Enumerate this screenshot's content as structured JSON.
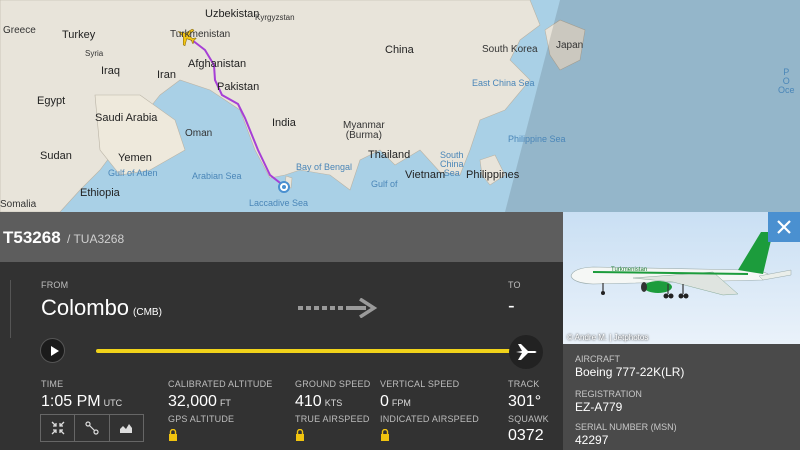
{
  "map": {
    "labels": {
      "uzbekistan": "Uzbekistan",
      "kyrgyzstan": "Kyrgyzstan",
      "turkmenistan": "Turkmenistan",
      "greece": "Greece",
      "turkey": "Turkey",
      "syria": "Syria",
      "iraq": "Iraq",
      "iran": "Iran",
      "afghanistan": "Afghanistan",
      "pakistan": "Pakistan",
      "china": "China",
      "south_korea": "South Korea",
      "japan": "Japan",
      "egypt": "Egypt",
      "saudi_arabia": "Saudi Arabia",
      "oman": "Oman",
      "india": "India",
      "myanmar": "Myanmar\n(Burma)",
      "east_china_sea": "East China Sea",
      "sudan": "Sudan",
      "yemen": "Yemen",
      "thailand": "Thailand",
      "south_china_sea": "South\nChina\nSea",
      "philippine_sea": "Philippine Sea",
      "gulf_of_aden": "Gulf of Aden",
      "bay_of_bengal": "Bay of Bengal",
      "arabian_sea": "Arabian Sea",
      "gulf_of": "Gulf of",
      "vietnam": "Vietnam",
      "philippines": "Philippines",
      "ethiopia": "Ethiopia",
      "laccadive_sea": "Laccadive Sea",
      "somalia": "Somalia",
      "pacific": "P\nO\nOce"
    }
  },
  "flight": {
    "callsign": "T53268",
    "separator_and_icao": "/ TUA3268"
  },
  "route": {
    "from_label": "FROM",
    "from_city": "Colombo",
    "from_code": "(CMB)",
    "to_label": "TO",
    "to_city": "-"
  },
  "stats": {
    "time_label": "TIME",
    "time_value": "1:05 PM",
    "time_unit": "UTC",
    "cal_alt_label": "CALIBRATED ALTITUDE",
    "cal_alt_value": "32,000",
    "cal_alt_unit": "FT",
    "gps_alt_label": "GPS ALTITUDE",
    "ground_speed_label": "GROUND SPEED",
    "ground_speed_value": "410",
    "ground_speed_unit": "KTS",
    "true_airspeed_label": "TRUE AIRSPEED",
    "vertical_speed_label": "VERTICAL SPEED",
    "vertical_speed_value": "0",
    "vertical_speed_unit": "FPM",
    "indicated_airspeed_label": "INDICATED AIRSPEED",
    "track_label": "TRACK",
    "track_value": "301°",
    "squawk_label": "SQUAWK",
    "squawk_value": "0372"
  },
  "progress_fraction": 1.0,
  "aircraft": {
    "photo_credit": "© Andre M. | Jetphotos",
    "type_label": "AIRCRAFT",
    "type_value": "Boeing 777-22K(LR)",
    "registration_label": "REGISTRATION",
    "registration_value": "EZ-A779",
    "serial_label": "SERIAL NUMBER (MSN)",
    "serial_value": "42297"
  },
  "colors": {
    "progress": "#f1d31a",
    "route_path": "#a63fd6",
    "close_button": "#4a90d0",
    "panel_dark": "#323232"
  }
}
